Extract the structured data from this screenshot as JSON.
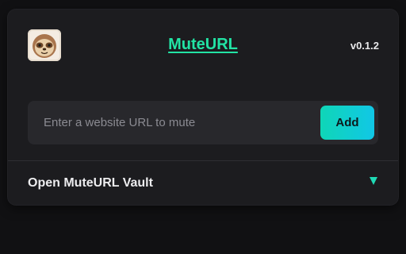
{
  "app": {
    "title": "MuteURL",
    "version": "v0.1.2",
    "logo_icon": "sloth-logo-icon"
  },
  "url_form": {
    "placeholder": "Enter a website URL to mute",
    "value": "",
    "add_label": "Add"
  },
  "vault": {
    "label": "Open MuteURL Vault",
    "toggle_icon": "triangle-down-icon"
  },
  "colors": {
    "accent": "#22e3a4",
    "button_gradient_start": "#0fd6b7",
    "button_gradient_end": "#11c7e6",
    "background": "#111113",
    "panel": "#1c1c1f"
  }
}
